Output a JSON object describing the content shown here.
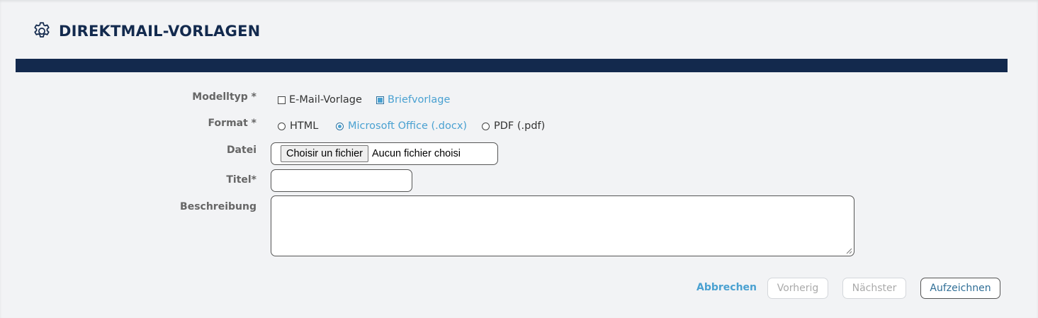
{
  "header": {
    "title": "DIREKTMAIL-VORLAGEN",
    "icon": "gear-icon"
  },
  "form": {
    "modelltyp": {
      "label": "Modelltyp *",
      "options": [
        {
          "label": "E-Mail-Vorlage",
          "checked": false
        },
        {
          "label": "Briefvorlage",
          "checked": true
        }
      ]
    },
    "format": {
      "label": "Format *",
      "options": [
        {
          "label": "HTML",
          "selected": false
        },
        {
          "label": "Microsoft Office (.docx)",
          "selected": true
        },
        {
          "label": "PDF (.pdf)",
          "selected": false
        }
      ]
    },
    "datei": {
      "label": "Datei",
      "button": "Choisir un fichier",
      "status": "Aucun fichier choisi"
    },
    "titel": {
      "label": "Titel*",
      "value": ""
    },
    "beschreibung": {
      "label": "Beschreibung",
      "value": ""
    }
  },
  "actions": {
    "cancel": "Abbrechen",
    "previous": "Vorherig",
    "next": "Nächster",
    "save": "Aufzeichnen"
  },
  "colors": {
    "band": "#13294d",
    "title": "#132a4e",
    "accent": "#4aa1d1",
    "background": "#f2f3f5"
  }
}
